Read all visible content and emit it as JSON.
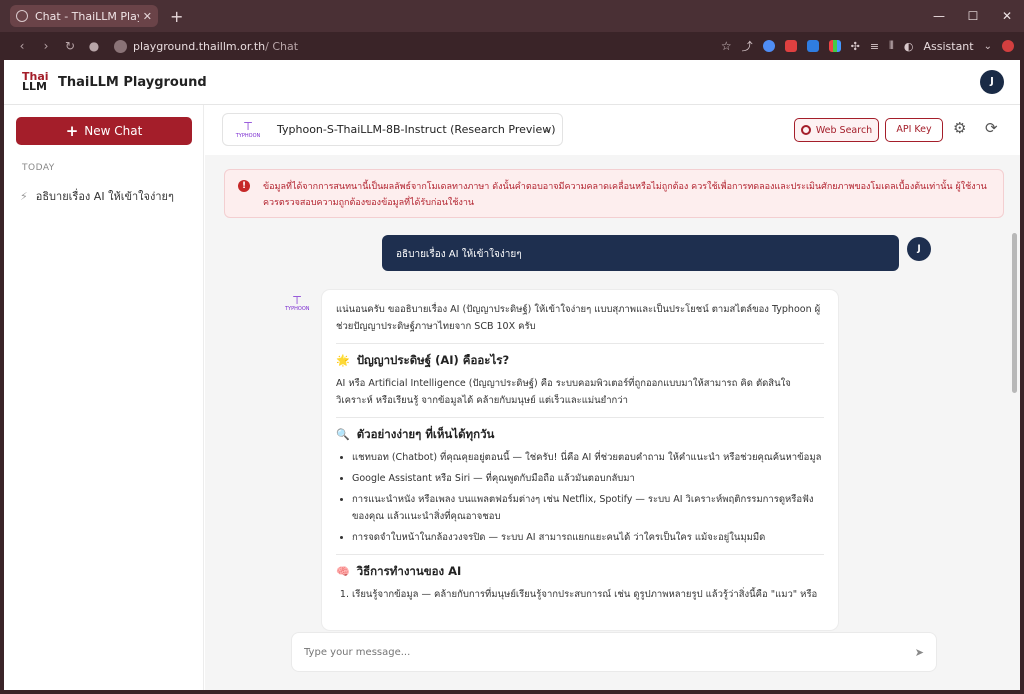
{
  "browser": {
    "tab_title": "Chat - ThaiLLM Playground",
    "url_host": "playground.thaillm.or.th",
    "url_path": " / Chat",
    "assistant_label": "Assistant"
  },
  "header": {
    "logo_line1": "Thai",
    "logo_line2": "LLM",
    "brand": "ThaiLLM Playground",
    "avatar": "J"
  },
  "sidebar": {
    "new_chat": "New Chat",
    "section_today": "TODAY",
    "history": [
      "อธิบายเรื่อง AI ให้เข้าใจง่ายๆ"
    ]
  },
  "toolbar": {
    "model_logo": "TYPHOON",
    "model_name": "Typhoon-S-ThaiLLM-8B-Instruct (Research Preview)",
    "web_search": "Web Search",
    "api_key": "API Key"
  },
  "warning": "ข้อมูลที่ได้จากการสนทนานี้เป็นผลลัพธ์จากโมเดลทางภาษา ดังนั้นคำตอบอาจมีความคลาดเคลื่อนหรือไม่ถูกต้อง ควรใช้เพื่อการทดลองและประเมินศักยภาพของโมเดลเบื้องต้นเท่านั้น ผู้ใช้งานควรตรวจสอบความถูกต้องของข้อมูลที่ได้รับก่อนใช้งาน",
  "user_message": {
    "text": "อธิบายเรื่อง AI ให้เข้าใจง่ายๆ",
    "avatar": "J"
  },
  "bot_message": {
    "logo": "TYPHOON",
    "intro": "แน่นอนครับ ขออธิบายเรื่อง AI (ปัญญาประดิษฐ์) ให้เข้าใจง่ายๆ แบบสุภาพและเป็นประโยชน์ ตามสไตล์ของ Typhoon ผู้ช่วยปัญญาประดิษฐ์ภาษาไทยจาก SCB 10X ครับ",
    "h1_emoji": "🌟",
    "h1": "ปัญญาประดิษฐ์ (AI) คืออะไร?",
    "p1": "AI หรือ Artificial Intelligence (ปัญญาประดิษฐ์) คือ ระบบคอมพิวเตอร์ที่ถูกออกแบบมาให้สามารถ คิด ตัดสินใจ วิเคราะห์ หรือเรียนรู้ จากข้อมูลได้ คล้ายกับมนุษย์ แต่เร็วและแม่นยำกว่า",
    "h2_emoji": "🔍",
    "h2": "ตัวอย่างง่ายๆ ที่เห็นได้ทุกวัน",
    "list": [
      "แชทบอท (Chatbot) ที่คุณคุยอยู่ตอนนี้ — ใช่ครับ! นี่คือ AI ที่ช่วยตอบคำถาม ให้คำแนะนำ หรือช่วยคุณค้นหาข้อมูล",
      "Google Assistant หรือ Siri — ที่คุณพูดกับมือถือ แล้วมันตอบกลับมา",
      "การแนะนำหนัง หรือเพลง บนแพลตฟอร์มต่างๆ เช่น Netflix, Spotify — ระบบ AI วิเคราะห์พฤติกรรมการดูหรือฟังของคุณ แล้วแนะนำสิ่งที่คุณอาจชอบ",
      "การจดจำใบหน้าในกล้องวงจรปิด — ระบบ AI สามารถแยกแยะคนได้ ว่าใครเป็นใคร แม้จะอยู่ในมุมมืด"
    ],
    "h3_emoji": "🧠",
    "h3": "วิธีการทำงานของ AI",
    "ol_first": "เรียนรู้จากข้อมูล — คล้ายกับการที่มนุษย์เรียนรู้จากประสบการณ์ เช่น ดูรูปภาพหลายรูป แล้วรู้ว่าสิ่งนี้คือ \"แมว\" หรือ"
  },
  "input": {
    "placeholder": "Type your message..."
  }
}
